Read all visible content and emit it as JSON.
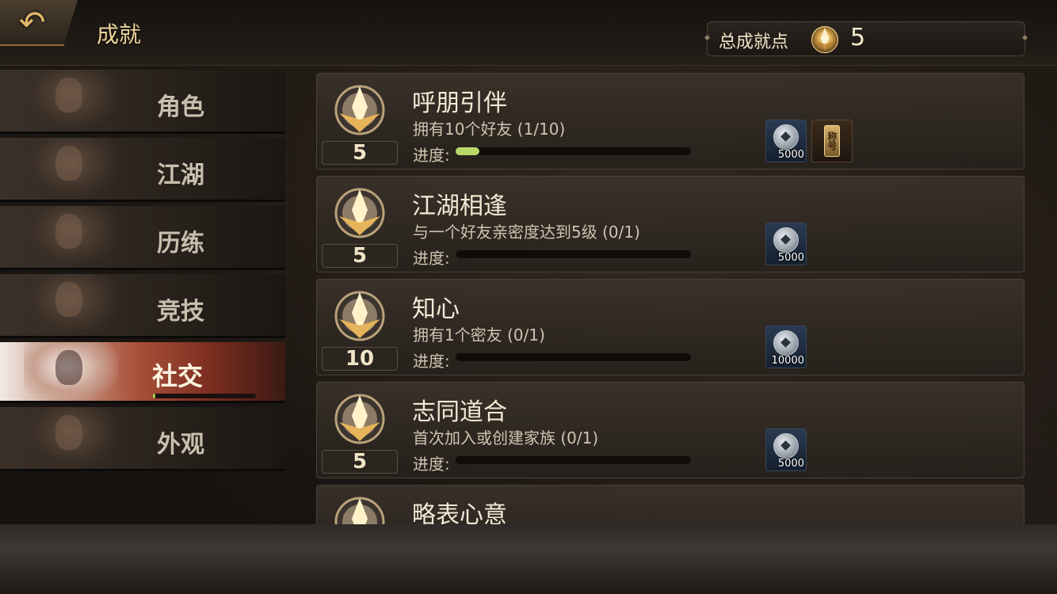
{
  "header": {
    "back_icon": "back-arrow-icon",
    "title": "成就",
    "total_label": "总成就点",
    "total_value": "5"
  },
  "sidebar": {
    "tabs": [
      {
        "label": "角色",
        "active": false
      },
      {
        "label": "江湖",
        "active": false
      },
      {
        "label": "历练",
        "active": false
      },
      {
        "label": "竞技",
        "active": false
      },
      {
        "label": "社交",
        "active": true,
        "progress": 0.02
      },
      {
        "label": "外观",
        "active": false
      }
    ]
  },
  "achievements": [
    {
      "title": "呼朋引伴",
      "desc": "拥有10个好友 (1/10)",
      "points": "5",
      "progress_label": "进度:",
      "progress": 0.1,
      "rewards": [
        {
          "type": "coin",
          "amount": "5000"
        },
        {
          "type": "title",
          "text": "称号"
        }
      ]
    },
    {
      "title": "江湖相逢",
      "desc": "与一个好友亲密度达到5级 (0/1)",
      "points": "5",
      "progress_label": "进度:",
      "progress": 0,
      "rewards": [
        {
          "type": "coin",
          "amount": "5000"
        }
      ]
    },
    {
      "title": "知心",
      "desc": "拥有1个密友 (0/1)",
      "points": "10",
      "progress_label": "进度:",
      "progress": 0,
      "rewards": [
        {
          "type": "coin",
          "amount": "10000"
        }
      ]
    },
    {
      "title": "志同道合",
      "desc": "首次加入或创建家族 (0/1)",
      "points": "5",
      "progress_label": "进度:",
      "progress": 0,
      "rewards": [
        {
          "type": "coin",
          "amount": "5000"
        }
      ]
    },
    {
      "title": "略表心意",
      "desc": "",
      "points": "",
      "progress_label": "",
      "progress": 0,
      "rewards": []
    }
  ],
  "colors": {
    "accent_gold": "#efd59b",
    "progress_green": "#b9d86a",
    "active_tab": "#a8503a"
  }
}
